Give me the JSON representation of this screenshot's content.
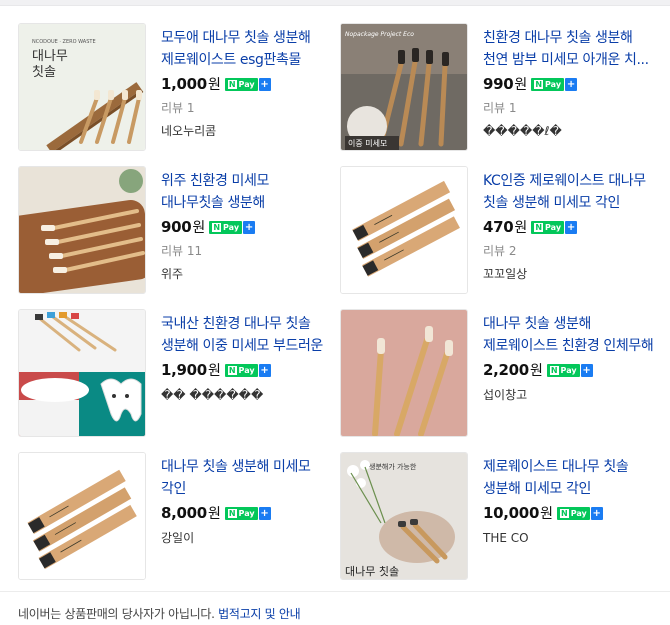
{
  "products": [
    {
      "title": "모두애 대나무 칫솔 생분해 제로웨이스트 esg판촉물",
      "price": "1,000",
      "currency": "원",
      "review": "리뷰 1",
      "seller": "네오누리콤",
      "thumb_text": "대나무 칫솔",
      "thumb_small": "NCODOUE · ZERO WASTE"
    },
    {
      "title": "친환경 대나무 칫솔 생분해 천연 밤부 미세모 아개운 치...",
      "price": "990",
      "currency": "원",
      "review": "리뷰 1",
      "seller": "�����ℓ�",
      "thumb_text": "이중 미세모",
      "thumb_small": "Nopackage Project Eco"
    },
    {
      "title": "위주 친환경 미세모 대나무칫솔 생분해 제로웨이스트 친...",
      "price": "900",
      "currency": "원",
      "review": "리뷰 11",
      "seller": "위주"
    },
    {
      "title": "KC인증 제로웨이스트 대나무 칫솔 생분해 미세모 각인",
      "price": "470",
      "currency": "원",
      "review": "리뷰 2",
      "seller": "꼬꼬일상"
    },
    {
      "title": "국내산 친환경 대나무 칫솔 생분해 이중 미세모 부드러운",
      "price": "1,900",
      "currency": "원",
      "review": "",
      "seller": "�� ������"
    },
    {
      "title": "대나무 칫솔 생분해 제로웨이스트 친환경 인체무해",
      "price": "2,200",
      "currency": "원",
      "review": "",
      "seller": "섭이창고"
    },
    {
      "title": "대나무 칫솔 생분해 미세모 각인",
      "price": "8,000",
      "currency": "원",
      "review": "",
      "seller": "강일이"
    },
    {
      "title": "제로웨이스트 대나무 칫솔 생분해 미세모 각인",
      "price": "10,000",
      "currency": "원",
      "review": "",
      "seller": "THE CO",
      "thumb_text": "대나무 칫솔",
      "thumb_small": "생분해가 가능한"
    }
  ],
  "npay": {
    "n": "N",
    "label": "Pay",
    "plus": "+"
  },
  "footer": {
    "text": "네이버는 상품판매의 당사자가 아닙니다.",
    "link": "법적고지 및 안내"
  },
  "colors": {
    "title": "#0a3ea8",
    "npay_green": "#03c75a",
    "npay_blue": "#1a7cf2"
  }
}
